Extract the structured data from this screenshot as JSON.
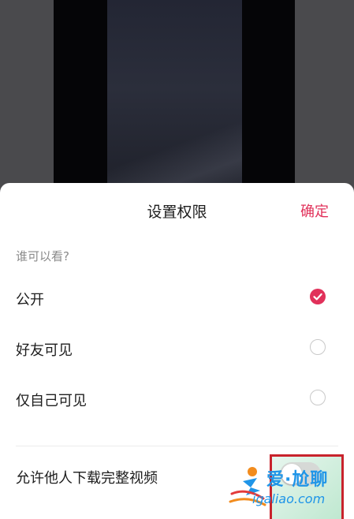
{
  "sheet": {
    "title": "设置权限",
    "confirm_label": "确定"
  },
  "visibility": {
    "question": "谁可以看?",
    "options": [
      {
        "label": "公开",
        "selected": true
      },
      {
        "label": "好友可见",
        "selected": false
      },
      {
        "label": "仅自己可见",
        "selected": false
      }
    ]
  },
  "download": {
    "label": "允许他人下载完整视频",
    "enabled": false
  },
  "watermark": {
    "title": "爱·尬聊",
    "url": "igaliao.com"
  },
  "colors": {
    "accent": "#e1315a",
    "highlight_border": "#c8232c",
    "watermark": "#1f95e8"
  }
}
